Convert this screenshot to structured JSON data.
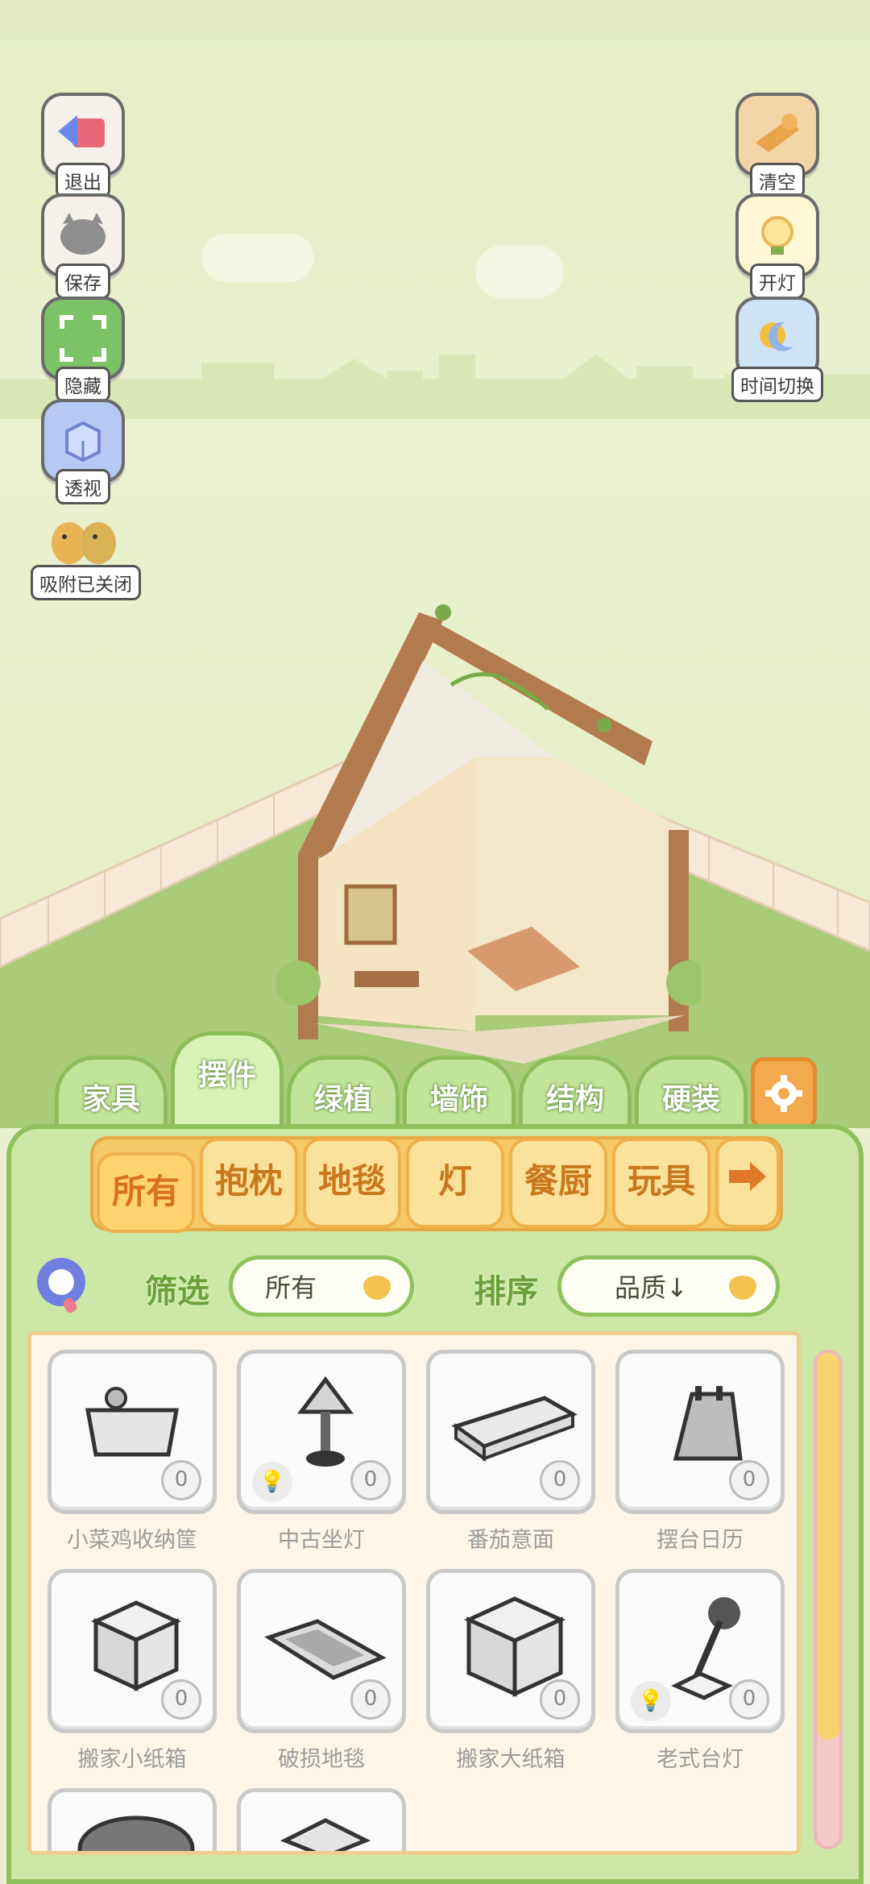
{
  "left_buttons": [
    {
      "label": "退出",
      "icon": "exit-arrow-icon"
    },
    {
      "label": "保存",
      "icon": "save-cat-icon"
    },
    {
      "label": "隐藏",
      "icon": "hide-frame-icon"
    },
    {
      "label": "透视",
      "icon": "perspective-cube-icon"
    },
    {
      "label": "吸附已关闭",
      "icon": "chicks-snap-icon"
    }
  ],
  "right_buttons": [
    {
      "label": "清空",
      "icon": "clear-broom-icon"
    },
    {
      "label": "开灯",
      "icon": "light-bulb-icon"
    },
    {
      "label": "时间切换",
      "icon": "sun-moon-icon"
    }
  ],
  "main_tabs": [
    "家具",
    "摆件",
    "绿植",
    "墙饰",
    "结构",
    "硬装"
  ],
  "active_main_tab": "摆件",
  "categories": [
    "所有",
    "抱枕",
    "地毯",
    "灯",
    "餐厨",
    "玩具"
  ],
  "active_category": "所有",
  "filter": {
    "label": "筛选",
    "value": "所有"
  },
  "sort": {
    "label": "排序",
    "value": "品质↓"
  },
  "items": [
    {
      "name": "小菜鸡收纳筐",
      "count": "0",
      "has_light": false
    },
    {
      "name": "中古坐灯",
      "count": "0",
      "has_light": true
    },
    {
      "name": "番茄意面",
      "count": "0",
      "has_light": false
    },
    {
      "name": "摆台日历",
      "count": "0",
      "has_light": false
    },
    {
      "name": "搬家小纸箱",
      "count": "0",
      "has_light": false
    },
    {
      "name": "破损地毯",
      "count": "0",
      "has_light": false
    },
    {
      "name": "搬家大纸箱",
      "count": "0",
      "has_light": false
    },
    {
      "name": "老式台灯",
      "count": "0",
      "has_light": true
    }
  ],
  "colors": {
    "panel": "#cde8a6",
    "accent_green": "#8fc15c",
    "category_yellow": "#f3c96a"
  }
}
